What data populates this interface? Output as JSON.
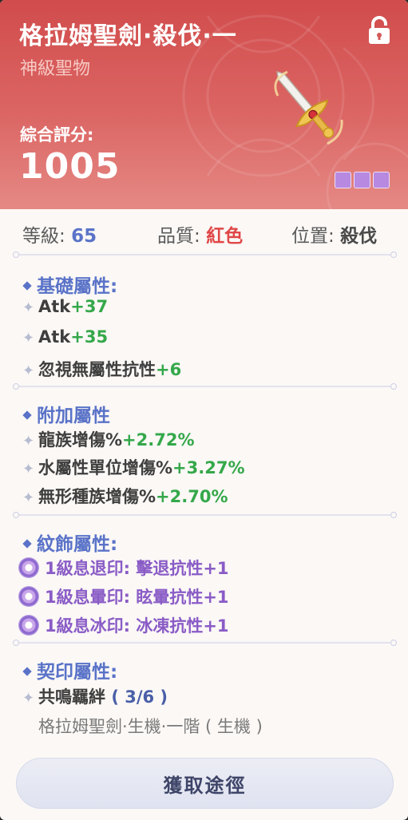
{
  "header": {
    "title": "格拉姆聖劍·殺伐·一",
    "subtitle": "神級聖物",
    "score_label": "綜合評分:",
    "score_value": "1005",
    "lock_icon": "lock-icon",
    "item_icon": "sword-icon",
    "slot_count": 3,
    "bg_color": "#d45352"
  },
  "info": {
    "level_label": "等級: ",
    "level_value": "65",
    "quality_label": "品質: ",
    "quality_value": "紅色",
    "position_label": "位置: ",
    "position_value": "殺伐"
  },
  "base": {
    "title": "基礎屬性:",
    "rows": [
      {
        "name": "Atk",
        "value": "+37"
      },
      {
        "name": "Atk",
        "value": "+35"
      },
      {
        "name": "忽視無屬性抗性",
        "value": "+6"
      }
    ]
  },
  "extra": {
    "title": "附加屬性",
    "rows": [
      {
        "name": "龍族增傷%",
        "value": "+2.72%"
      },
      {
        "name": "水屬性單位增傷%",
        "value": "+3.27%"
      },
      {
        "name": "無形種族增傷%",
        "value": "+2.70%"
      }
    ]
  },
  "pattern": {
    "title": "紋飾屬性:",
    "rows": [
      {
        "text": "1級息退印:  擊退抗性+1"
      },
      {
        "text": "1級息暈印:  眩暈抗性+1"
      },
      {
        "text": "1級息冰印:  冰凍抗性+1"
      }
    ]
  },
  "seal": {
    "title": "契印屬性:",
    "resonance": "共鳴羈絆",
    "count": "( 3/6 )",
    "detail": "格拉姆聖劍·生機·一階 ( 生機 )"
  },
  "button": {
    "label": "獲取途徑"
  }
}
